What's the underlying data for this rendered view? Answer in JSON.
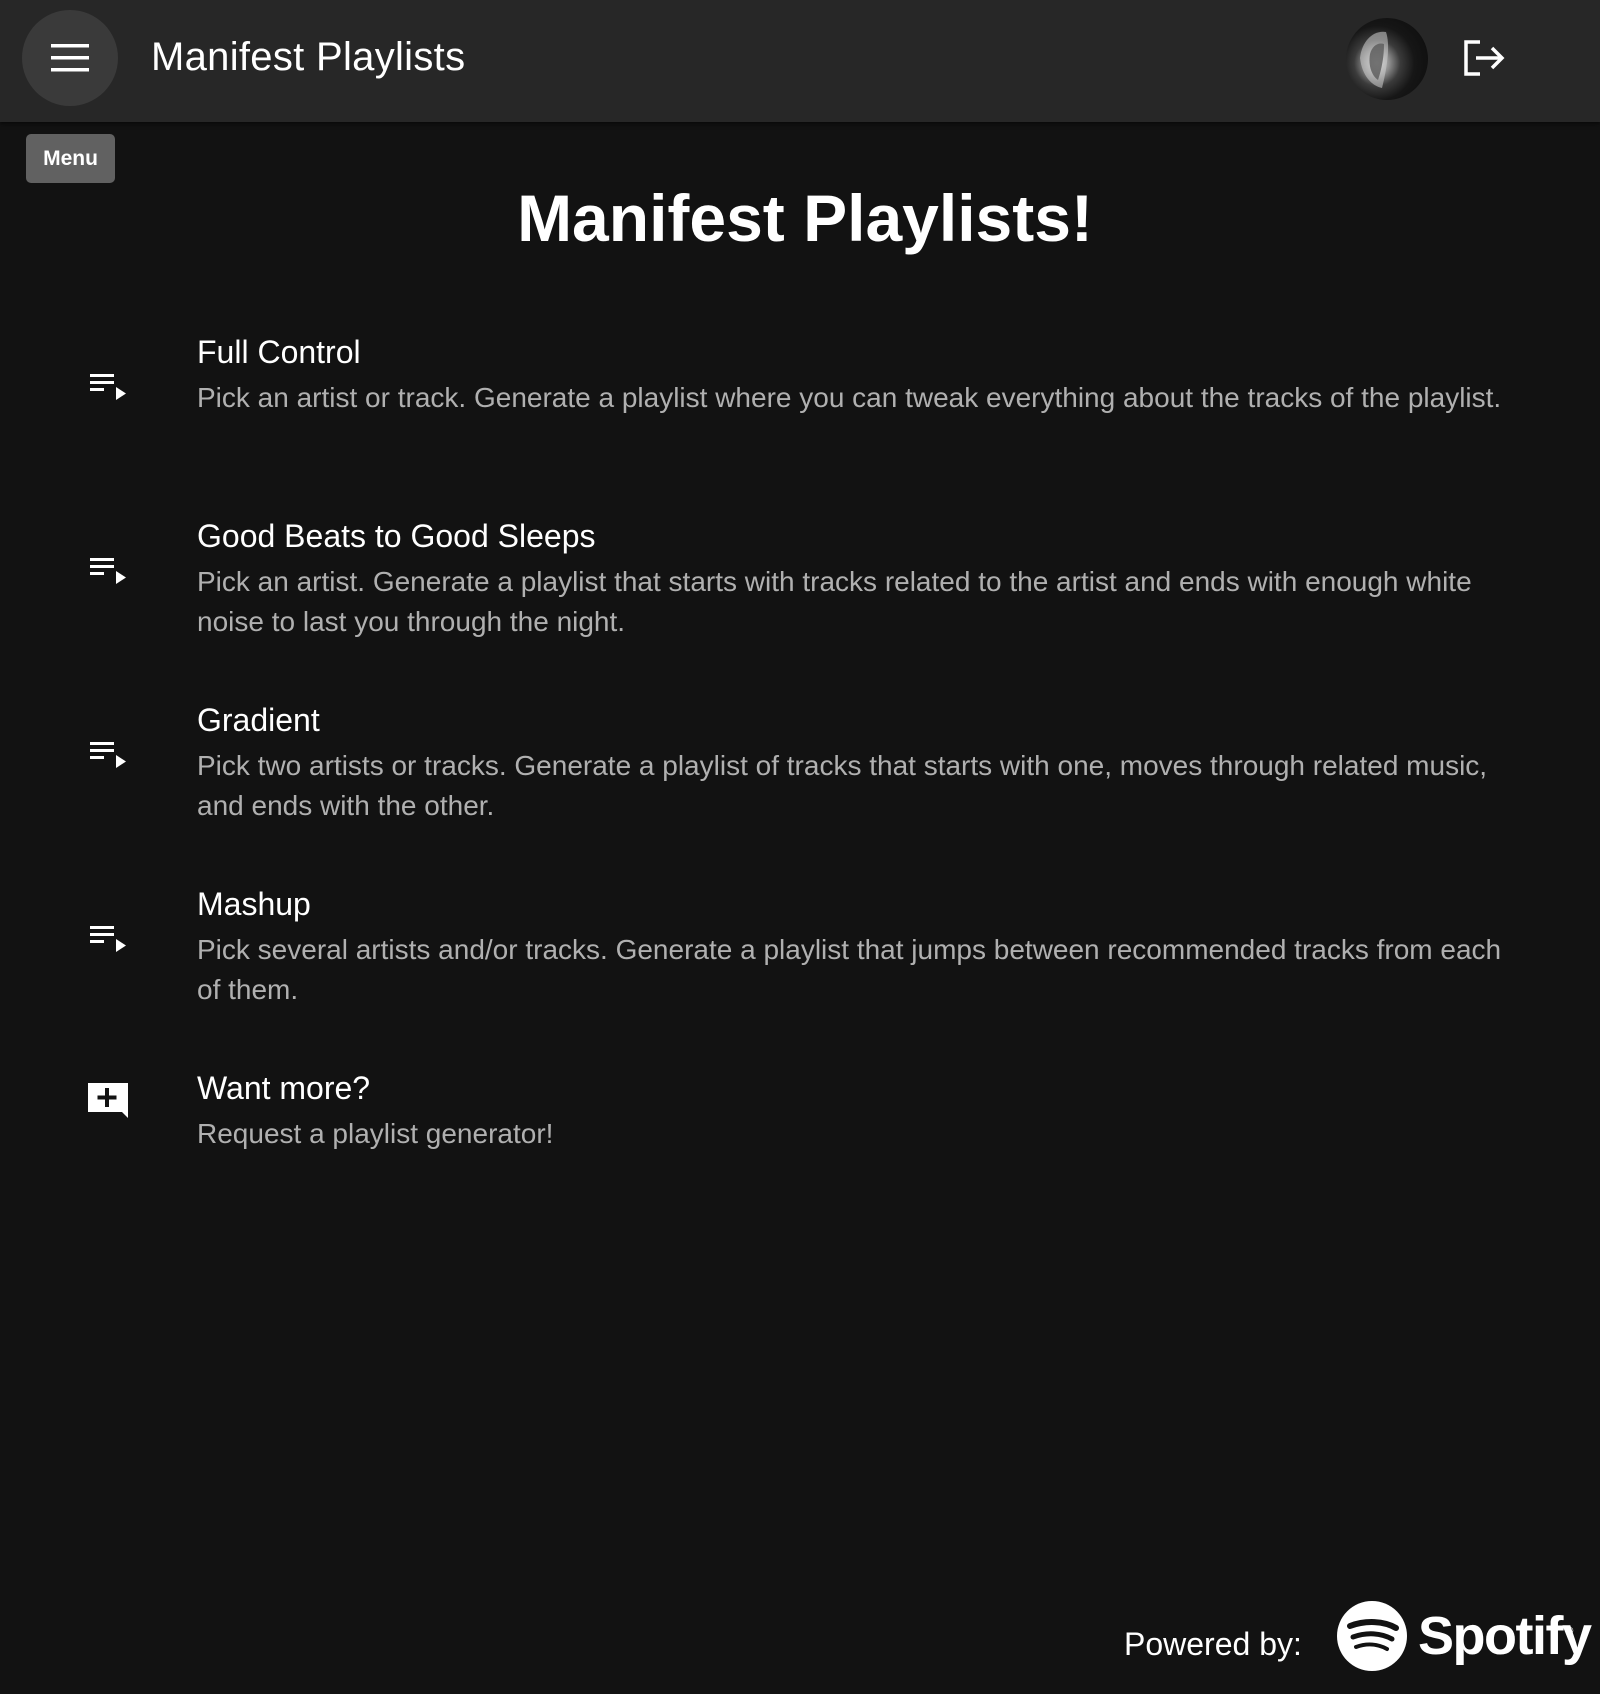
{
  "header": {
    "title": "Manifest Playlists",
    "menu_icon": "menu-icon",
    "avatar_icon": "user-avatar",
    "logout_icon": "logout-icon"
  },
  "tooltip": {
    "label": "Menu"
  },
  "main": {
    "heading": "Manifest Playlists!",
    "items": [
      {
        "icon": "playlist-play-icon",
        "title": "Full Control",
        "description": "Pick an artist or track. Generate a playlist where you can tweak everything about the tracks of the playlist."
      },
      {
        "icon": "playlist-play-icon",
        "title": "Good Beats to Good Sleeps",
        "description": "Pick an artist. Generate a playlist that starts with tracks related to the artist and ends with enough white noise to last you through the night."
      },
      {
        "icon": "playlist-play-icon",
        "title": "Gradient",
        "description": "Pick two artists or tracks. Generate a playlist of tracks that starts with one, moves through related music, and ends with the other."
      },
      {
        "icon": "playlist-play-icon",
        "title": "Mashup",
        "description": "Pick several artists and/or tracks. Generate a playlist that jumps between recommended tracks from each of them."
      },
      {
        "icon": "add-comment-icon",
        "title": "Want more?",
        "description": "Request a playlist generator!"
      }
    ]
  },
  "footer": {
    "powered_by": "Powered by:",
    "brand": "Spotify",
    "registered_mark": "®"
  },
  "colors": {
    "background": "#121212",
    "app_bar": "#272727",
    "tooltip": "#616161",
    "secondary_text": "#b0b0b0"
  }
}
